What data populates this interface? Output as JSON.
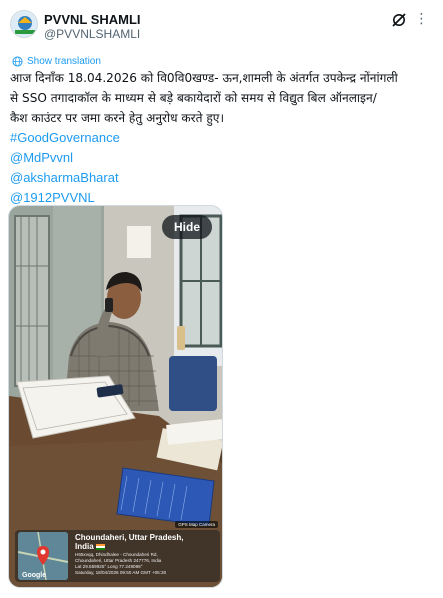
{
  "author": {
    "name": "PVVNL SHAMLI",
    "handle": "@PVVNLSHAMLI"
  },
  "translate_label": "Show translation",
  "post": {
    "lines": [
      "आज दिनाँक 18.04.2026 को वि0वि0खण्ड- ऊन,शामली के अंतर्गत उपकेन्द्र नोंनांगली",
      "से SSO तगादाकॉल के माध्यम से बड़े बकायेदारों को समय से विद्युत बिल ऑनलाइन/",
      "कैश काउंटर पर जमा करने हेतु अनुरोध करते हुए।"
    ],
    "hashtags": [
      "#GoodGovernance",
      "@MdPvvnl",
      "@aksharmaBharat",
      "@1912PVVNL"
    ]
  },
  "media": {
    "hide_label": "Hide",
    "geo_location": "Choundaheri, Uttar Pradesh,",
    "geo_country": "India",
    "geo_address": "H65xvqq, Dhindhalee - Choundaheri Rd,",
    "geo_address2": "Choundaheri, Uttar Pradesh 247776, India",
    "geo_coords": "Lat 29.559925° Long 77.249098°",
    "geo_timestamp": "Saturday, 18/04/2026 09:50 AM GMT +05:30",
    "geo_camera": "GPS Map Camera",
    "map_logo": "Google"
  },
  "colors": {
    "link": "#1d9bf0",
    "text": "#0f1419",
    "muted": "#536471"
  },
  "icons": {
    "grok": "grok-icon",
    "more": "more-icon",
    "translate": "globe-icon"
  }
}
